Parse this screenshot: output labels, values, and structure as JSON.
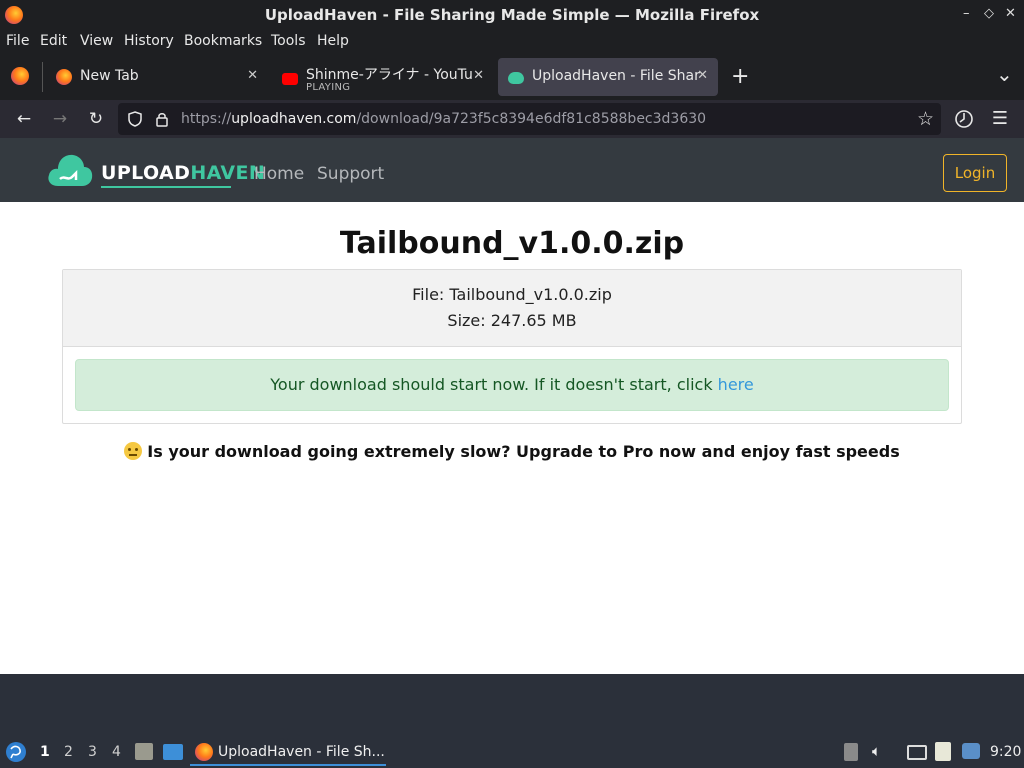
{
  "window": {
    "title": "UploadHaven - File Sharing Made Simple — Mozilla Firefox",
    "controls": [
      "–",
      "◇",
      "✕"
    ]
  },
  "menubar": {
    "items": [
      {
        "label": "File"
      },
      {
        "label": "Edit"
      },
      {
        "label": "View"
      },
      {
        "label": "History"
      },
      {
        "label": "Bookmarks"
      },
      {
        "label": "Tools"
      },
      {
        "label": "Help"
      }
    ]
  },
  "tabs": [
    {
      "label": "New Tab",
      "close": "✕"
    },
    {
      "label": "Shinme-アライナ - YouTube",
      "sub": "PLAYING",
      "close": "✕"
    },
    {
      "label": "UploadHaven - File Sharing",
      "close": "✕"
    }
  ],
  "tabstrip": {
    "new_tab": "+",
    "list_all": "⌄"
  },
  "navbar": {
    "url_prefix": "https://",
    "url_host": "uploadhaven.com",
    "url_path": "/download/9a723f5c8394e6df81c8588bec3d3630"
  },
  "site": {
    "logo_upload": "UPLOAD",
    "logo_haven": "HAVEN",
    "nav": [
      "Home",
      "Support"
    ],
    "login": "Login",
    "brand_color": "#3fc7a0",
    "login_color": "#f0b429"
  },
  "main": {
    "title": "Tailbound_v1.0.0.zip",
    "file_line": "File: Tailbound_v1.0.0.zip",
    "size_line": "Size: 247.65 MB",
    "alert_text": "Your download should start now. If it doesn't start, click ",
    "alert_link": "here",
    "upgrade_text": "Is your download going extremely slow? Upgrade to Pro now and enjoy fast speeds"
  },
  "taskbar": {
    "workspaces": [
      "1",
      "2",
      "3",
      "4"
    ],
    "task_label": "UploadHaven - File Sh...",
    "clock": "9:20"
  }
}
